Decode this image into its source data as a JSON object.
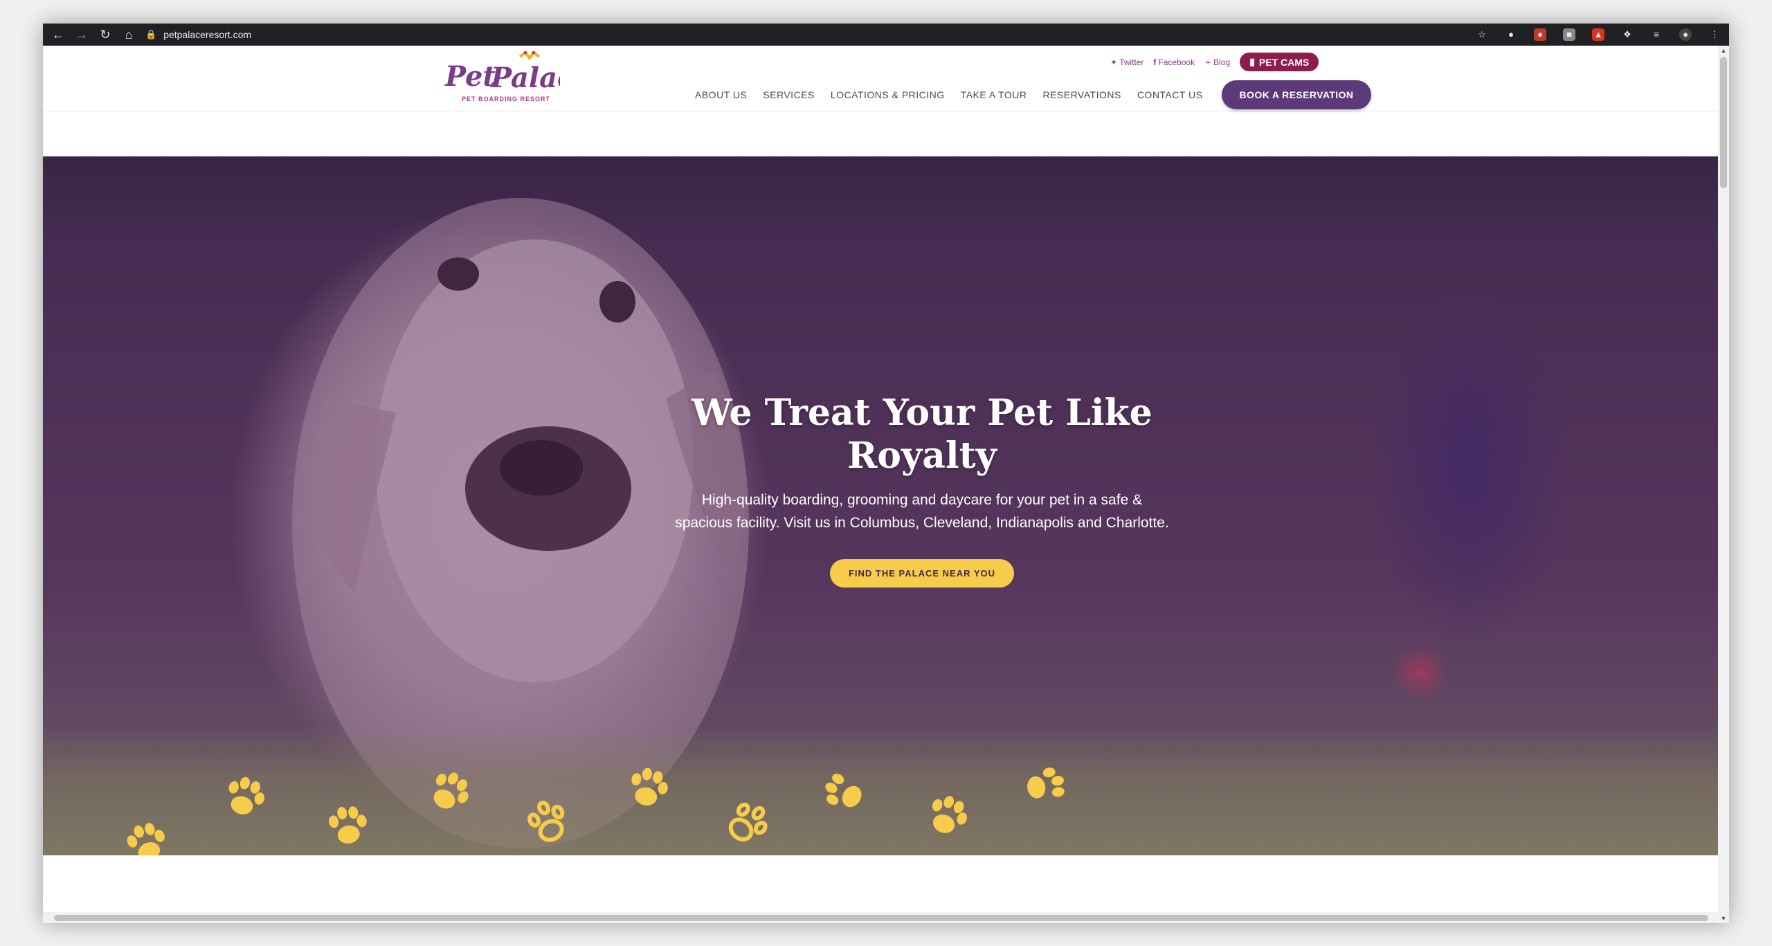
{
  "browser": {
    "url": "petpalaceresort.com"
  },
  "brand": {
    "logo_text": "Pet Palace",
    "logo_tagline": "PET BOARDING RESORT",
    "purple": "#5c3a7a",
    "magenta": "#8c1d4e",
    "yellow": "#f6cc4a"
  },
  "social": {
    "twitter": "Twitter",
    "facebook": "Facebook",
    "blog": "Blog",
    "petcams": "PET CAMS"
  },
  "nav": {
    "items": [
      "ABOUT US",
      "SERVICES",
      "LOCATIONS & PRICING",
      "TAKE A TOUR",
      "RESERVATIONS",
      "CONTACT US"
    ],
    "book": "BOOK A RESERVATION"
  },
  "hero": {
    "title": "We Treat Your Pet Like Royalty",
    "subtitle": "High-quality boarding, grooming and daycare for your pet in a safe & spacious facility. Visit us in Columbus, Cleveland, Indianapolis and Charlotte.",
    "cta": "FIND THE PALACE NEAR YOU"
  }
}
